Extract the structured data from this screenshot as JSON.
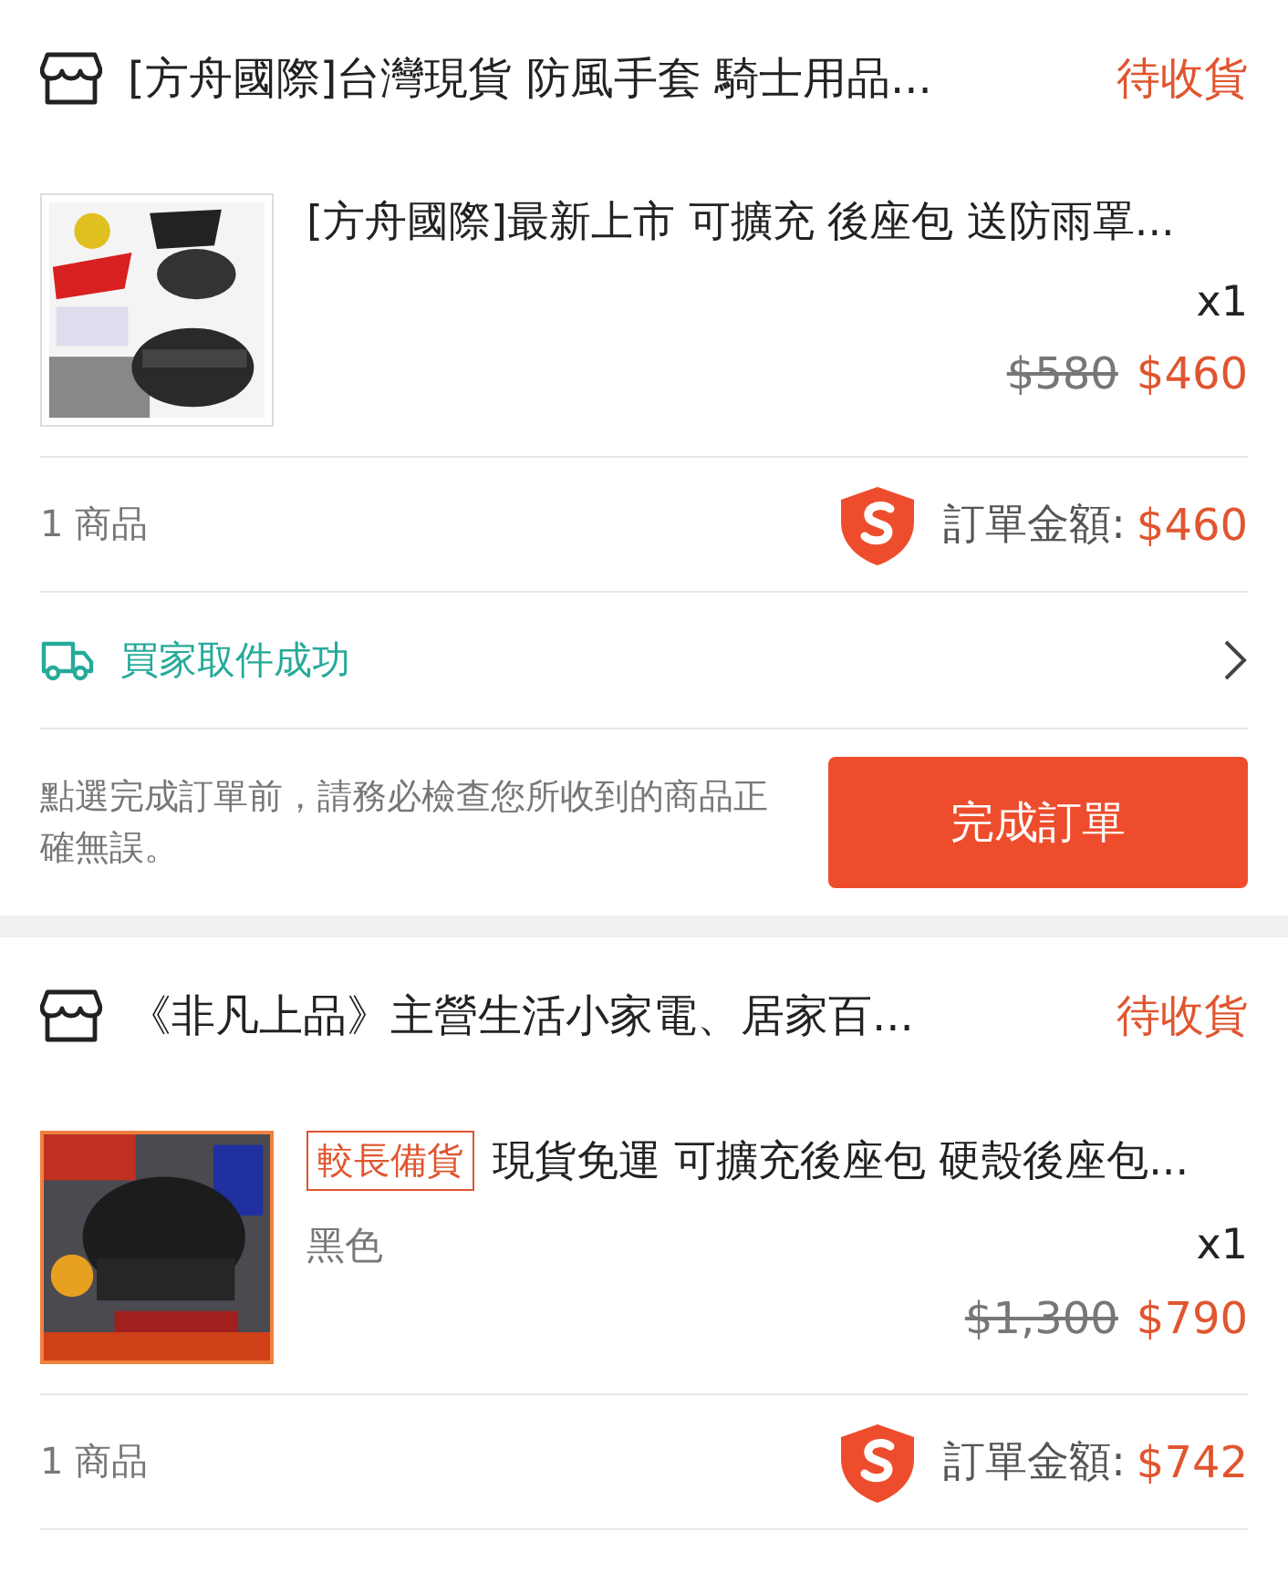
{
  "orders": [
    {
      "shop": "[方舟國際]台灣現貨 防風手套 騎士用品...",
      "status": "待收貨",
      "item": {
        "name": "[方舟國際]最新上市 可擴充 後座包 送防雨罩...",
        "quantity": "x1",
        "original_price": "$580",
        "price": "$460",
        "kind": "picture"
      },
      "count": "1 商品",
      "total_label": "訂單金額:",
      "total": "$460",
      "delivery": "買家取件成功",
      "note": "點選完成訂單前，請務必檢查您所收到的商品正確無誤。",
      "action": "完成訂單"
    },
    {
      "shop": "《非凡上品》主營生活小家電、居家百...",
      "status": "待收貨",
      "item": {
        "tag": "較長備貨",
        "name": "現貨免運 可擴充後座包 硬殼後座包...",
        "variant": "黑色",
        "quantity": "x1",
        "original_price": "$1,300",
        "price": "$790",
        "kind": "picture"
      },
      "count": "1 商品",
      "total_label": "訂單金額:",
      "total": "$742"
    }
  ]
}
